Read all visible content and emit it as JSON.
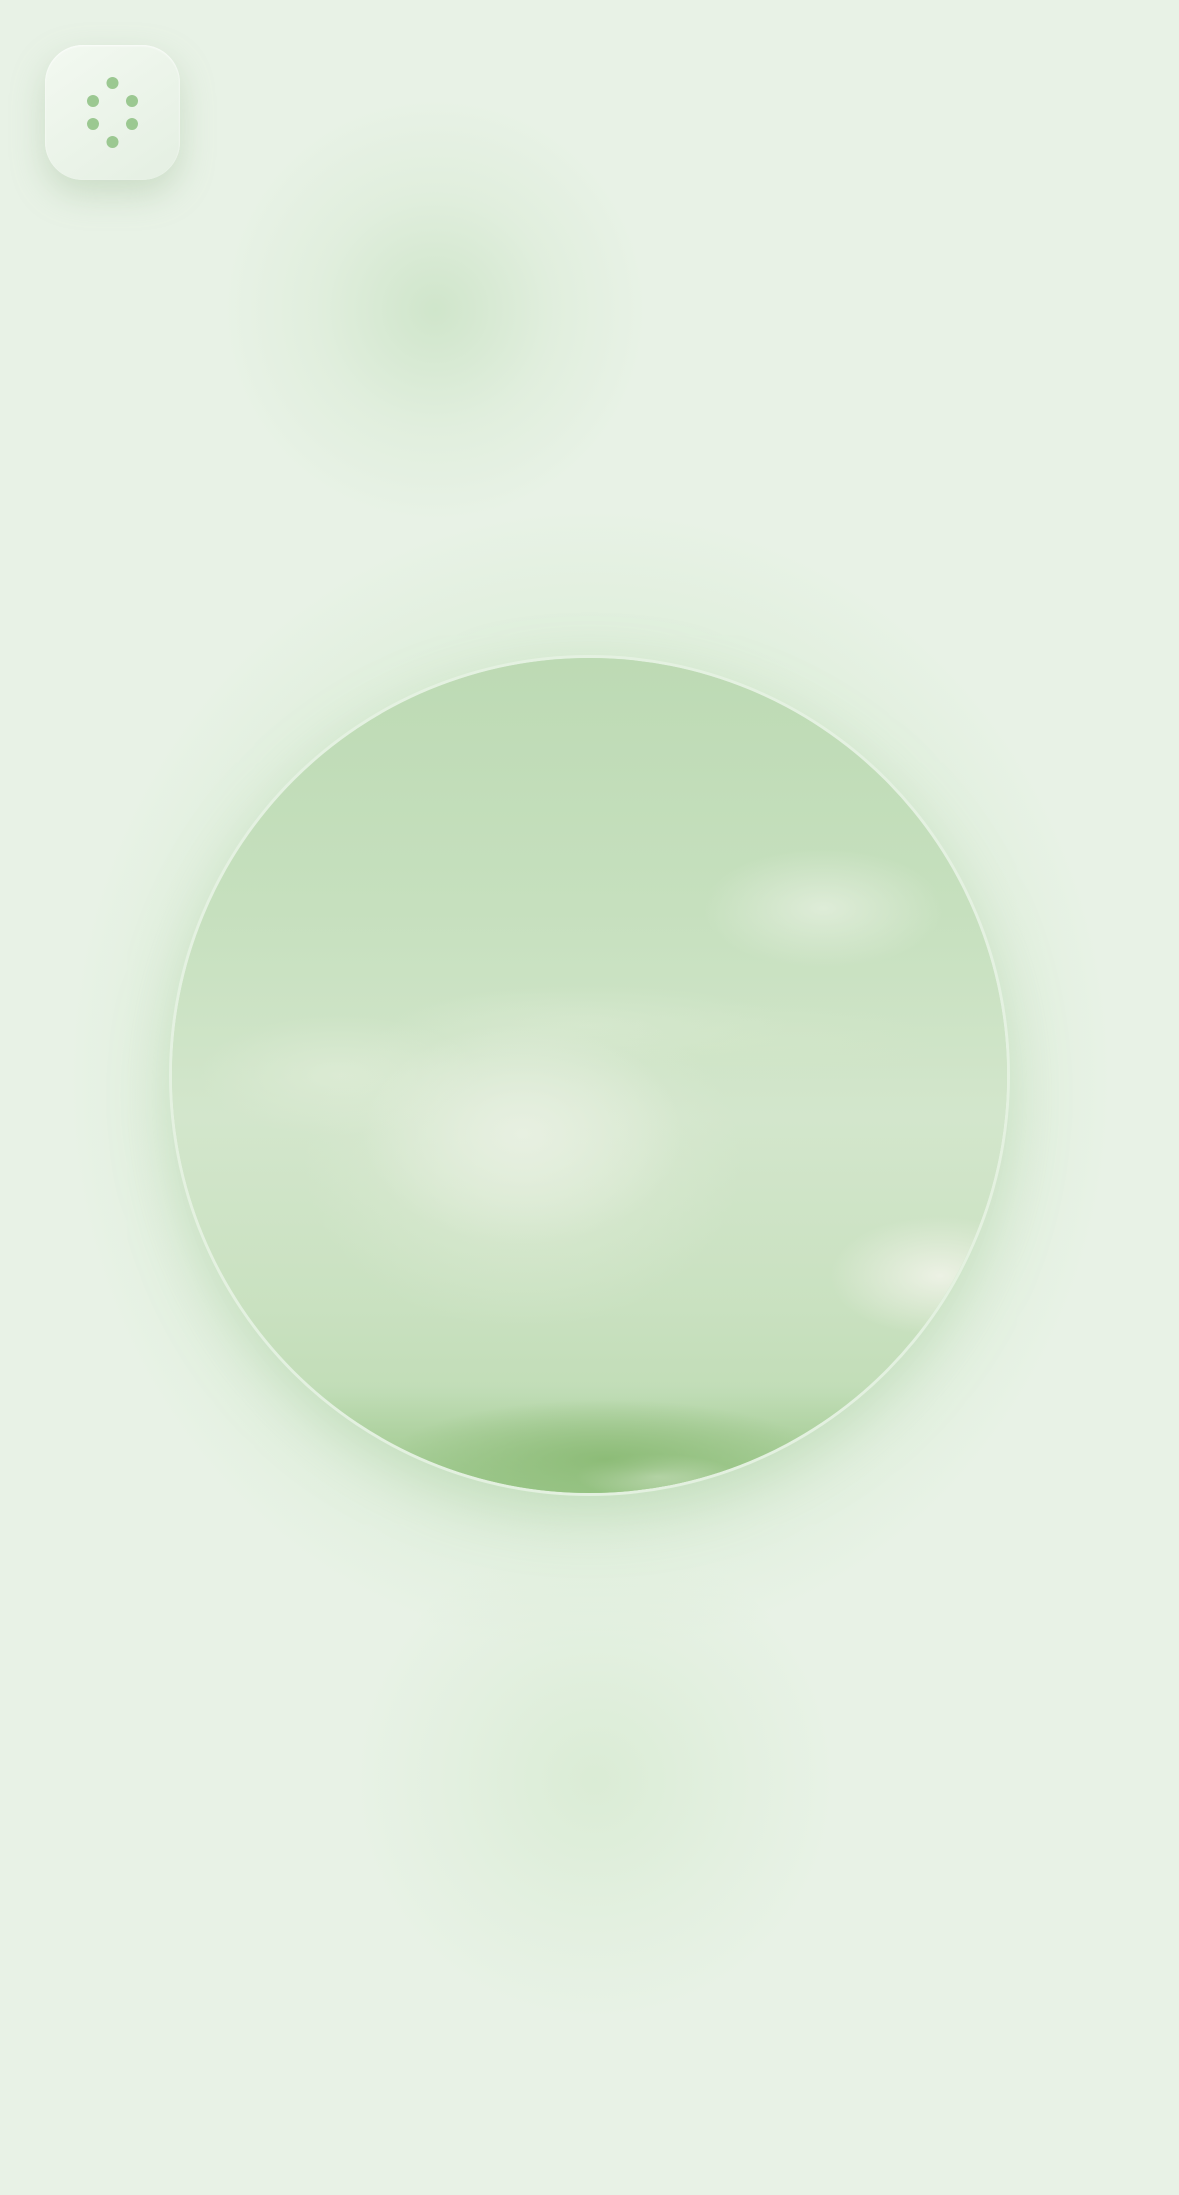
{
  "screen": {
    "background_color": "#e8f2e6",
    "accent_color": "#8cbf82"
  },
  "menu_button": {
    "icon": "dots-ring-icon",
    "dot_color": "#9bc891"
  },
  "hero": {
    "kind": "blurred-circular-image",
    "dominant_color": "#c6e0be"
  }
}
